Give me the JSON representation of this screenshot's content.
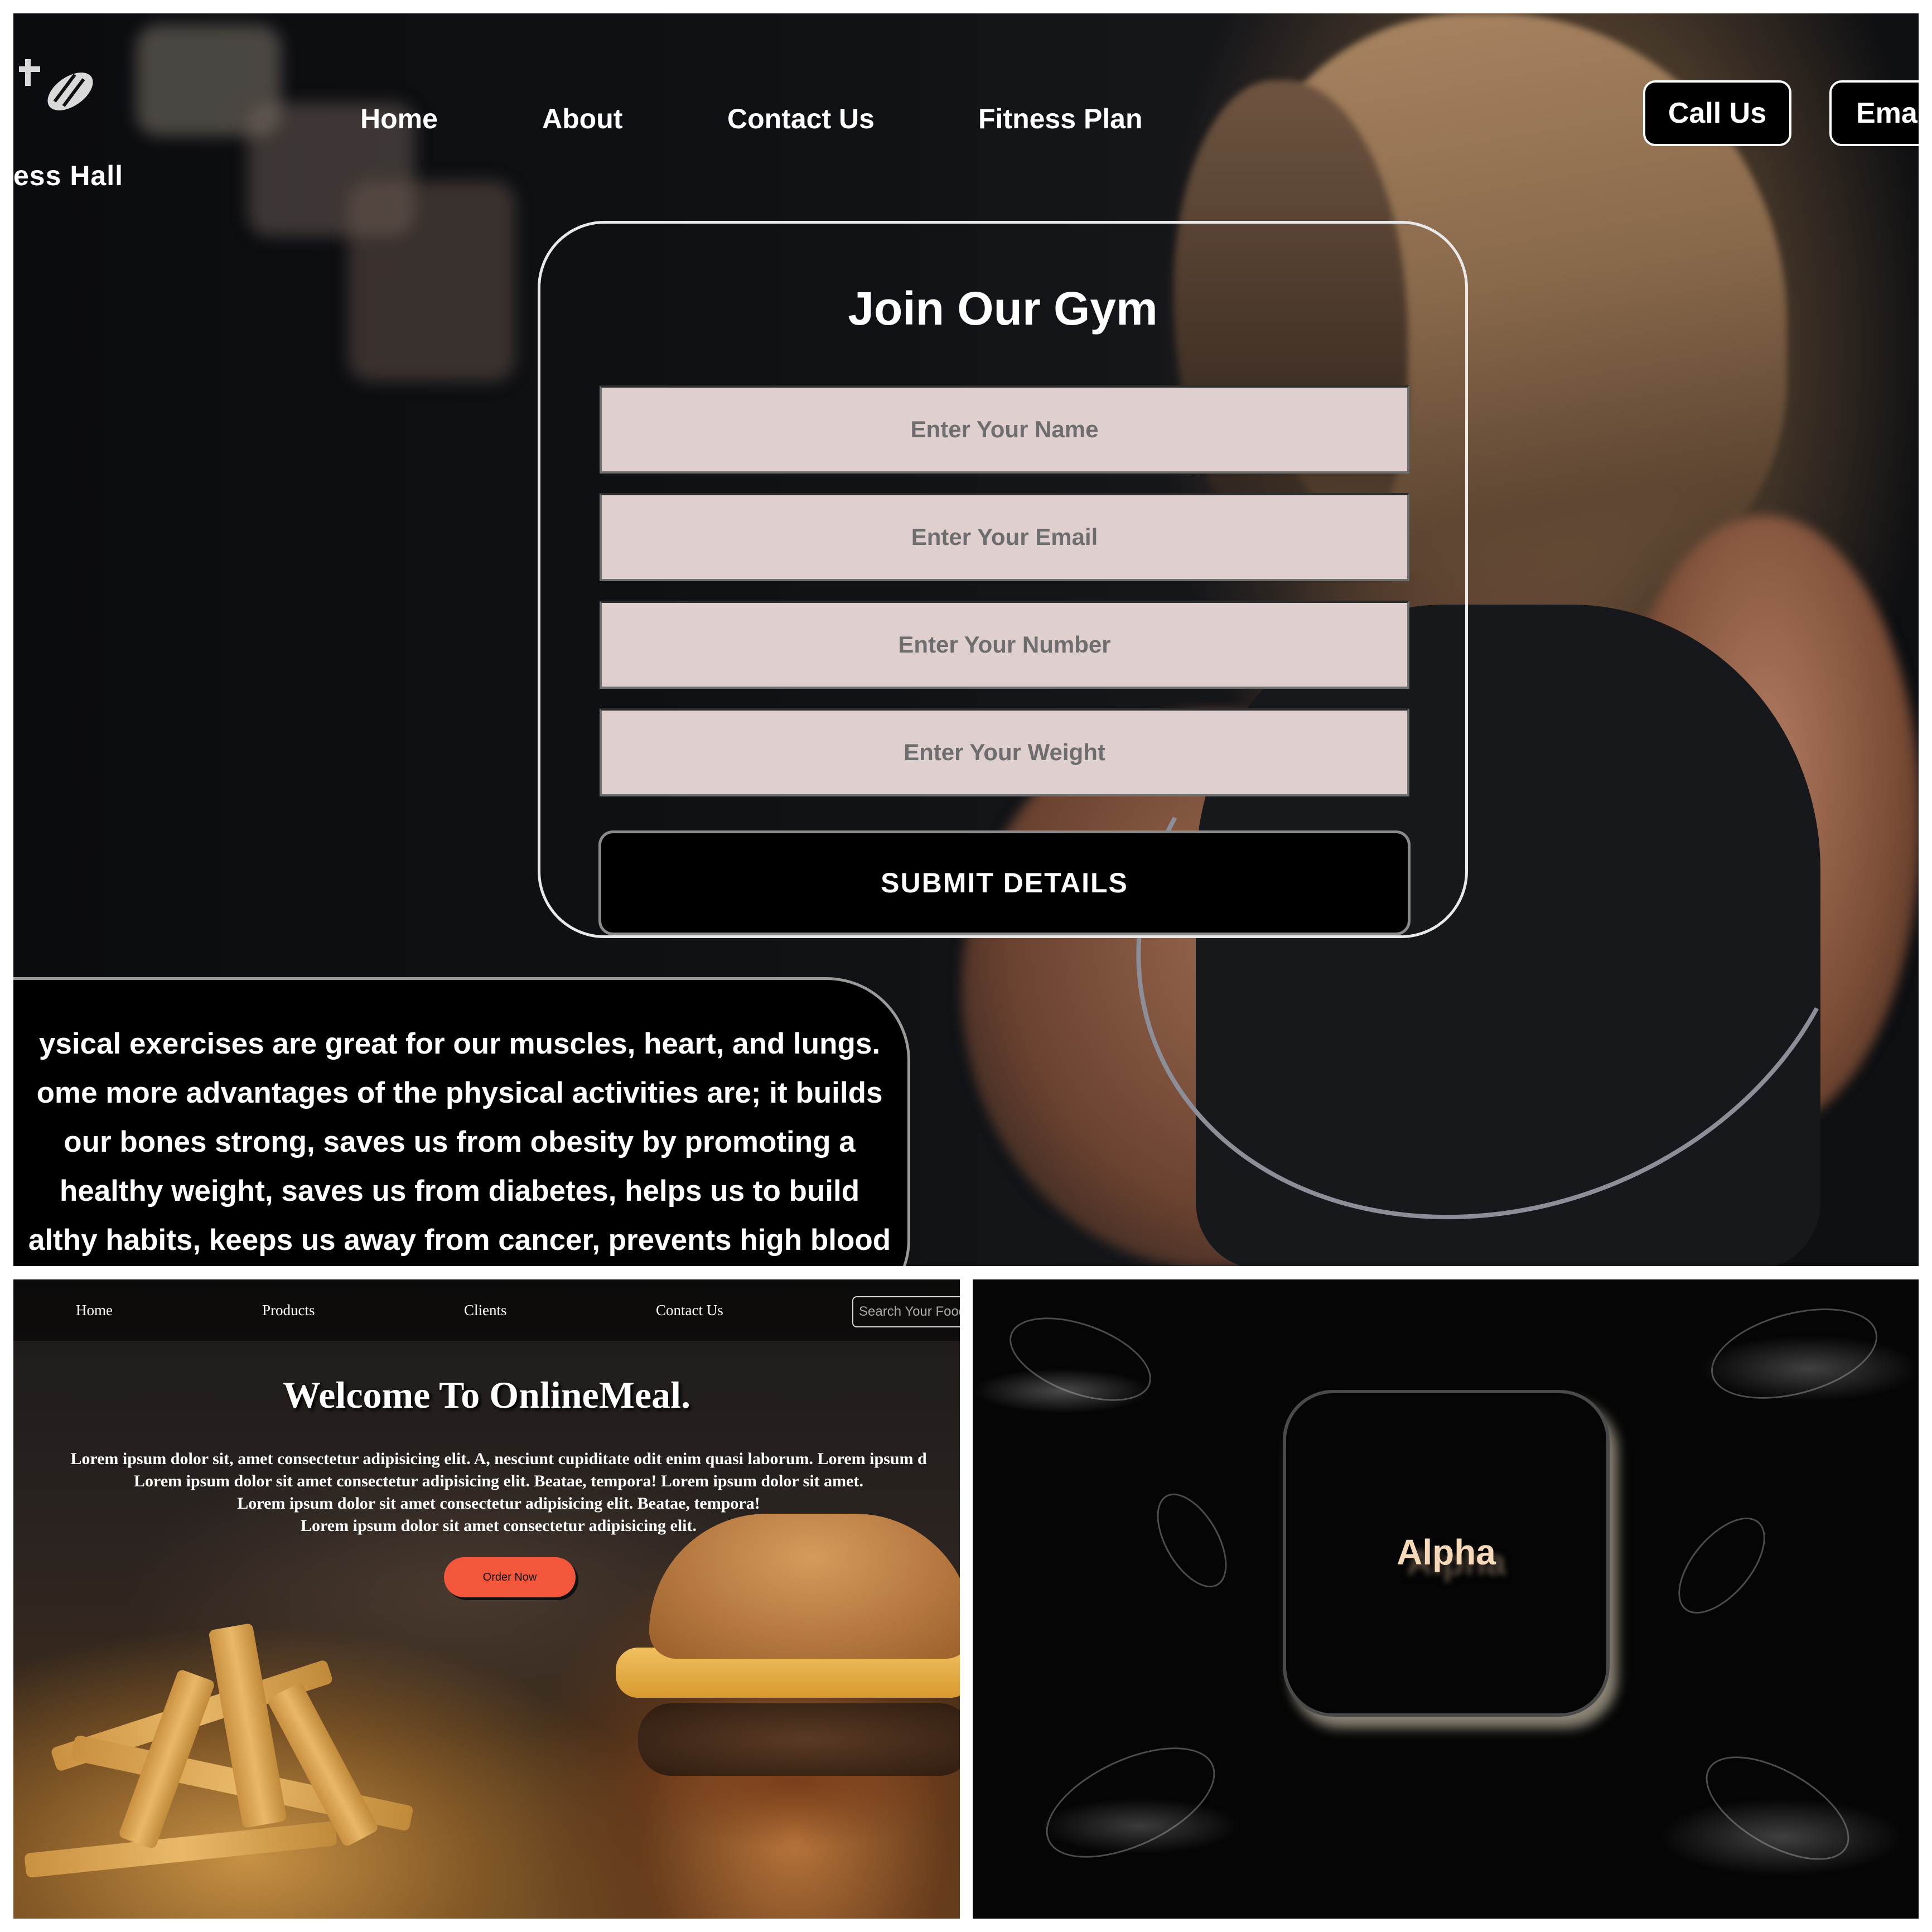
{
  "gym": {
    "brand": "ess Hall",
    "nav": [
      "Home",
      "About",
      "Contact Us",
      "Fitness Plan"
    ],
    "buttons": {
      "call": "Call Us",
      "email": "Ema"
    },
    "form": {
      "title": "Join Our Gym",
      "name_placeholder": "Enter Your Name",
      "email_placeholder": "Enter Your Email",
      "number_placeholder": "Enter Your Number",
      "weight_placeholder": "Enter Your Weight",
      "submit": "SUBMIT DETAILS"
    },
    "paragraph": "ysical exercises are great for our muscles, heart, and lungs.\nome more advantages of the physical activities are; it builds\nour bones strong, saves us from obesity by promoting a\nhealthy weight, saves us from diabetes, helps us to build\nalthy habits, keeps us away from cancer, prevents high blood",
    "colors": {
      "input_bg": "#e0cfcf",
      "button_bg": "#000000"
    }
  },
  "food": {
    "nav": [
      "Home",
      "Products",
      "Clients",
      "Contact Us"
    ],
    "search_placeholder": "Search Your Food",
    "title": "Welcome To OnlineMeal.",
    "lorem": "Lorem ipsum dolor sit, amet consectetur adipisicing elit. A, nesciunt cupiditate odit enim quasi laborum. Lorem ipsum d\nLorem ipsum dolor sit amet consectetur adipisicing elit. Beatae, tempora! Lorem ipsum dolor sit amet.\nLorem ipsum dolor sit amet consectetur adipisicing elit. Beatae, tempora!\nLorem ipsum dolor sit amet consectetur adipisicing elit.",
    "order_button": "Order Now",
    "colors": {
      "order_button": "#f2563b"
    }
  },
  "alpha": {
    "label": "Alpha",
    "colors": {
      "text": "#f5d9b8",
      "card_shadow": "#8b8476"
    }
  }
}
